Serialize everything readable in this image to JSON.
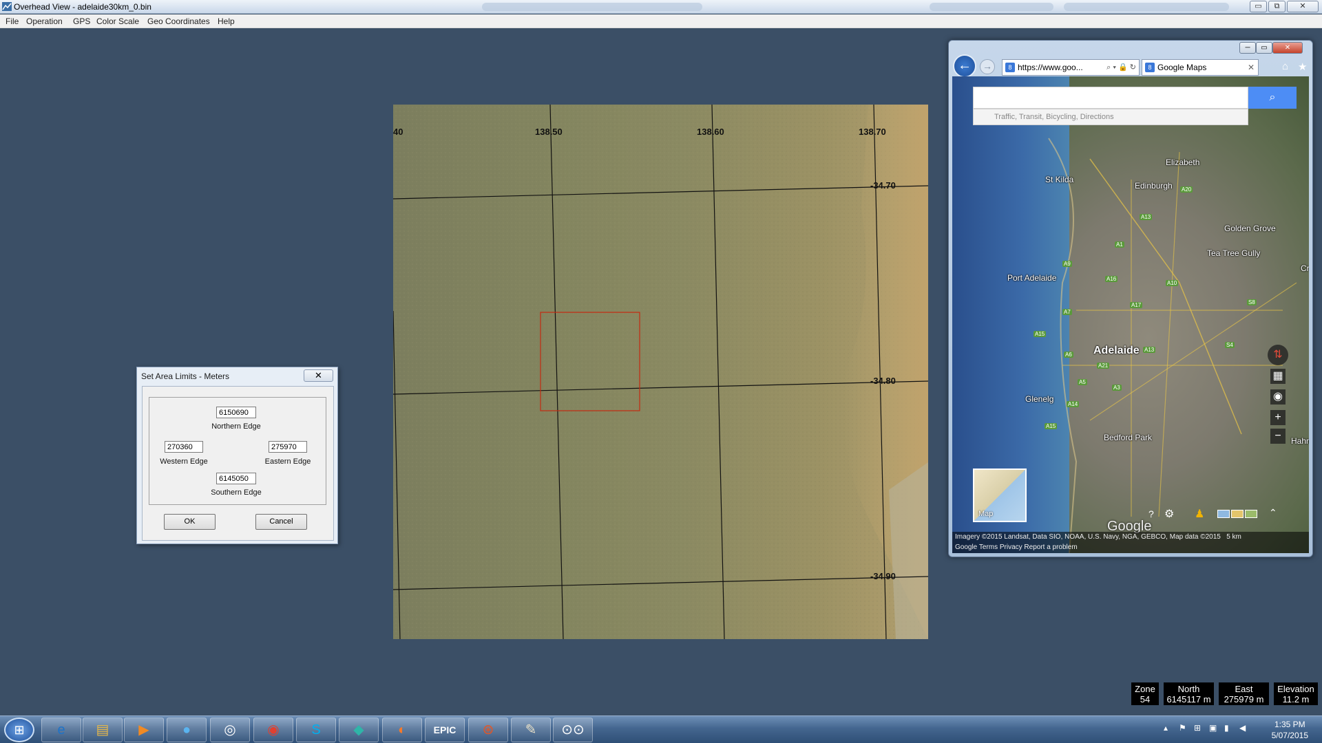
{
  "window": {
    "title": "Overhead View - adelaide30km_0.bin",
    "minimize": "▭",
    "maximize": "⧉",
    "close": "✕"
  },
  "menu": [
    "File",
    "Operation",
    "GPS",
    "Color Scale",
    "Geo Coordinates",
    "Help"
  ],
  "map": {
    "lon_labels": [
      "40",
      "138.50",
      "138.60",
      "138.70"
    ],
    "lat_labels": [
      "-34.70",
      "-34.80",
      "-34.90"
    ]
  },
  "dialog": {
    "title": "Set Area Limits - Meters",
    "close": "✕",
    "northern_value": "6150690",
    "northern_label": "Northern Edge",
    "western_value": "270360",
    "western_label": "Western Edge",
    "eastern_value": "275970",
    "eastern_label": "Eastern Edge",
    "southern_value": "6145050",
    "southern_label": "Southern Edge",
    "ok": "OK",
    "cancel": "Cancel"
  },
  "browser": {
    "address": "https://www.goo...",
    "tab_title": "Google Maps",
    "search_placeholder": "",
    "search_hint": "Traffic, Transit, Bicycling, Directions",
    "places": [
      "Elizabeth",
      "St Kilda",
      "Edinburgh",
      "Golden Grove",
      "Tea Tree Gully",
      "Port Adelaide",
      "Adelaide",
      "Glenelg",
      "Bedford Park",
      "Hahn",
      "Cr"
    ],
    "roads": [
      "A20",
      "A13",
      "A1",
      "A9",
      "A16",
      "A10",
      "A7",
      "A17",
      "A15",
      "A6",
      "A21",
      "A5",
      "A3",
      "A14",
      "A15",
      "A13",
      "S4",
      "S8"
    ],
    "thumb_label": "Map",
    "brand": "Google",
    "credit_line1": "Imagery ©2015 Landsat, Data SIO, NOAA, U.S. Navy, NGA, GEBCO, Map data ©2015",
    "scale": "5 km",
    "credit_links": "Google    Terms    Privacy    Report a problem"
  },
  "status": {
    "zone_label": "Zone",
    "zone_value": "54",
    "north_label": "North",
    "north_value": "6145117 m",
    "east_label": "East",
    "east_value": "275979 m",
    "elev_label": "Elevation",
    "elev_value": "11.2  m"
  },
  "taskbar": {
    "start_icon": "windows-start-icon",
    "apps": [
      "internet-explorer-icon",
      "file-explorer-icon",
      "media-player-icon",
      "chat-icon",
      "steam-icon",
      "chrome-icon",
      "skype-icon",
      "app-icon",
      "blender-icon",
      "epic-games-icon",
      "ubuntu-icon",
      "paint-icon",
      "glasses-icon"
    ],
    "epic_label": "EPIC",
    "time": "1:35 PM",
    "date": "5/07/2015"
  }
}
